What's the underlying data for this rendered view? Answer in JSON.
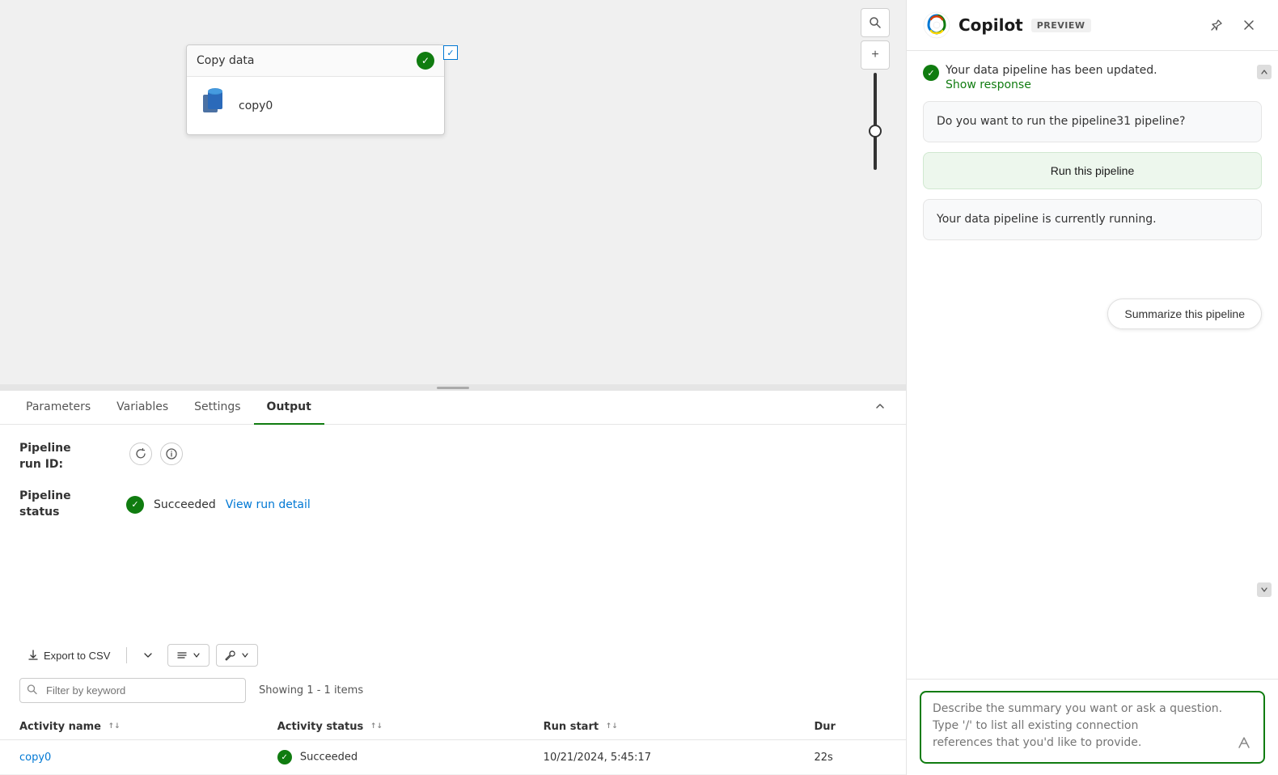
{
  "canvas": {
    "node": {
      "title": "Copy data",
      "activity_name": "copy0",
      "check_symbol": "✓"
    },
    "toolbar": {
      "search_label": "🔍",
      "plus_label": "+"
    }
  },
  "output": {
    "tabs": [
      {
        "label": "Parameters",
        "active": false
      },
      {
        "label": "Variables",
        "active": false
      },
      {
        "label": "Settings",
        "active": false
      },
      {
        "label": "Output",
        "active": true
      }
    ],
    "pipeline_run_label": "Pipeline\nrun ID:",
    "pipeline_status_label": "Pipeline\nstatus",
    "status_text": "Succeeded",
    "view_run_link": "View run detail",
    "toolbar": {
      "export_csv": "Export to CSV",
      "filter_columns_label": "≡",
      "tools_label": "🔧"
    },
    "filter_placeholder": "Filter by keyword",
    "showing_text": "Showing 1 - 1 items",
    "table": {
      "columns": [
        {
          "label": "Activity name",
          "sortable": true
        },
        {
          "label": "Activity status",
          "sortable": true
        },
        {
          "label": "Run start",
          "sortable": true
        },
        {
          "label": "Dur",
          "sortable": false
        }
      ],
      "rows": [
        {
          "activity_name": "copy0",
          "status": "Succeeded",
          "run_start": "10/21/2024, 5:45:17",
          "duration": "22s"
        }
      ]
    }
  },
  "copilot": {
    "title": "Copilot",
    "preview_badge": "PREVIEW",
    "messages": [
      {
        "type": "updated",
        "text": "Your data pipeline has been updated.",
        "link_text": "Show response"
      },
      {
        "type": "bot",
        "text": "Do you want to run the pipeline31 pipeline?"
      },
      {
        "type": "run_button",
        "label": "Run this pipeline"
      },
      {
        "type": "bot",
        "text": "Your data pipeline is currently running."
      }
    ],
    "summarize_bubble": "Summarize this pipeline",
    "input": {
      "placeholder_line1": "Describe the summary you want or ask a",
      "placeholder_line2": "question.",
      "placeholder_line3": "Type '/' to list all existing connection",
      "placeholder_line4": "references that you'd like to provide."
    }
  }
}
